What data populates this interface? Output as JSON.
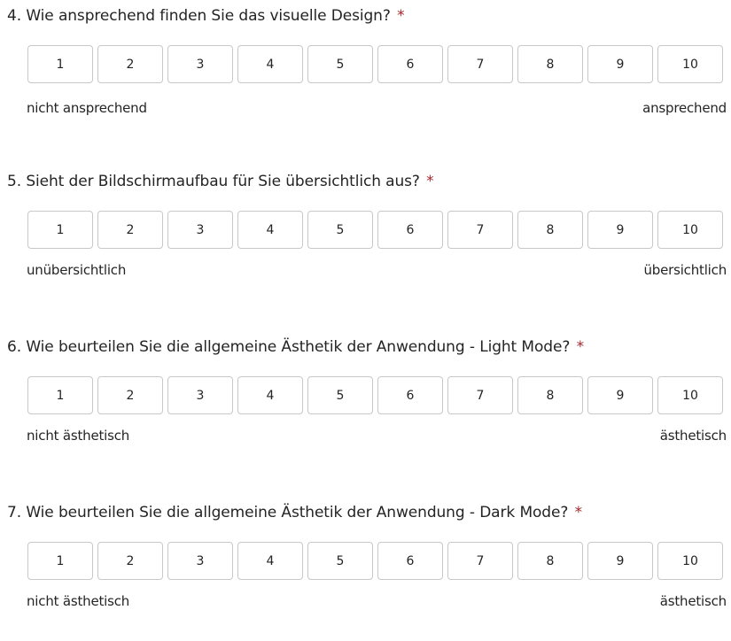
{
  "questions": [
    {
      "title": "4. Wie ansprechend finden Sie das visuelle Design?",
      "required_marker": "*",
      "options": [
        "1",
        "2",
        "3",
        "4",
        "5",
        "6",
        "7",
        "8",
        "9",
        "10"
      ],
      "left_label": "nicht ansprechend",
      "right_label": "ansprechend"
    },
    {
      "title": "5. Sieht der Bildschirmaufbau für Sie übersichtlich aus?",
      "required_marker": "*",
      "options": [
        "1",
        "2",
        "3",
        "4",
        "5",
        "6",
        "7",
        "8",
        "9",
        "10"
      ],
      "left_label": "unübersichtlich",
      "right_label": "übersichtlich"
    },
    {
      "title": "6. Wie beurteilen Sie die allgemeine Ästhetik der Anwendung - Light Mode?",
      "required_marker": "*",
      "options": [
        "1",
        "2",
        "3",
        "4",
        "5",
        "6",
        "7",
        "8",
        "9",
        "10"
      ],
      "left_label": "nicht ästhetisch",
      "right_label": "ästhetisch"
    },
    {
      "title": "7. Wie beurteilen Sie die allgemeine Ästhetik der Anwendung - Dark Mode?",
      "required_marker": "*",
      "options": [
        "1",
        "2",
        "3",
        "4",
        "5",
        "6",
        "7",
        "8",
        "9",
        "10"
      ],
      "left_label": "nicht ästhetisch",
      "right_label": "ästhetisch"
    }
  ],
  "colors": {
    "required_marker": "#a4262c",
    "option_border": "#c8c8c8",
    "text": "#242424"
  }
}
